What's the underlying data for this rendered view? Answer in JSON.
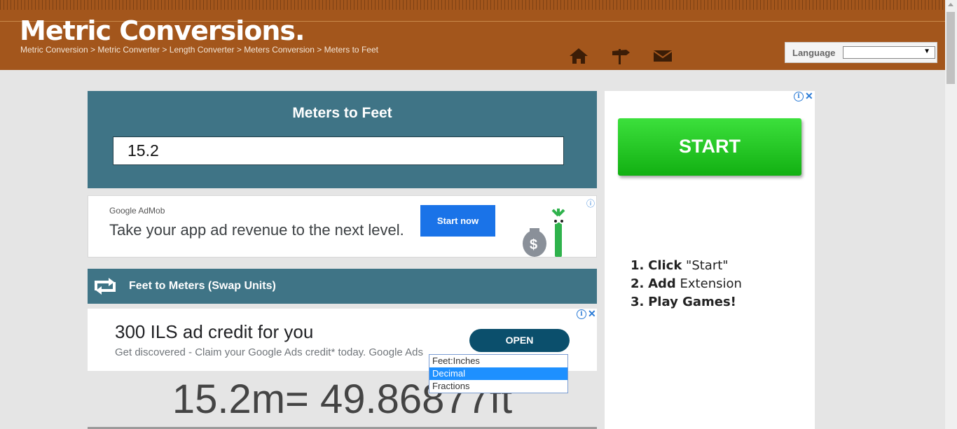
{
  "header": {
    "logo": "Metric Conversions.",
    "breadcrumb": [
      "Metric Conversion",
      "Metric Converter",
      "Length Converter",
      "Meters Conversion",
      "Meters to Feet"
    ],
    "breadcrumb_separator": " > ",
    "icons": [
      "home-icon",
      "signpost-icon",
      "mail-icon"
    ],
    "language_label": "Language",
    "language_value": ""
  },
  "converter": {
    "title": "Meters to Feet",
    "input_value": "15.2"
  },
  "ad_admob": {
    "brand_google": "Google",
    "brand_product": " AdMob",
    "headline": "Take your app ad revenue to the next level.",
    "button": "Start now"
  },
  "swap": {
    "label": "Feet to Meters (Swap Units)"
  },
  "ad_google": {
    "title": "300 ILS ad credit for you",
    "subtitle": "Get discovered - Claim your Google Ads credit* today. Google Ads",
    "button": "OPEN"
  },
  "result": {
    "text": "15.2m= 49.86877ft"
  },
  "format_dropdown": {
    "options": [
      "Feet:Inches",
      "Decimal",
      "Fractions"
    ],
    "selected": "Decimal"
  },
  "side_ad": {
    "button": "START",
    "steps": [
      {
        "num": "1.",
        "bold": "Click",
        "rest": " \"Start\""
      },
      {
        "num": "2.",
        "bold": "Add",
        "rest": " Extension"
      },
      {
        "num": "3.",
        "bold": "Play Games!",
        "rest": ""
      }
    ]
  },
  "colors": {
    "header_bg": "#a3561c",
    "panel_bg": "#3f7486",
    "start_green": "#22c322",
    "ad_blue": "#1a73e8"
  }
}
